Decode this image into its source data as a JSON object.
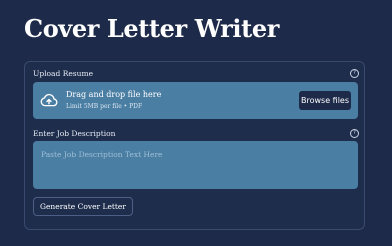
{
  "app": {
    "title": "Cover Letter Writer"
  },
  "upload": {
    "label": "Upload Resume",
    "help_icon": "help-circle-icon",
    "dropzone_title": "Drag and drop file here",
    "dropzone_subtitle": "Limit 5MB per file • PDF",
    "upload_icon": "cloud-upload-icon",
    "browse_label": "Browse files"
  },
  "job": {
    "label": "Enter Job Description",
    "help_icon": "help-circle-icon",
    "placeholder": "Paste Job Description Text Here",
    "value": ""
  },
  "actions": {
    "generate_label": "Generate Cover Letter"
  },
  "colors": {
    "background": "#1d2a49",
    "input_fill": "#4a7ea3",
    "button_fill": "#1d2a49",
    "text": "#ffffff"
  }
}
